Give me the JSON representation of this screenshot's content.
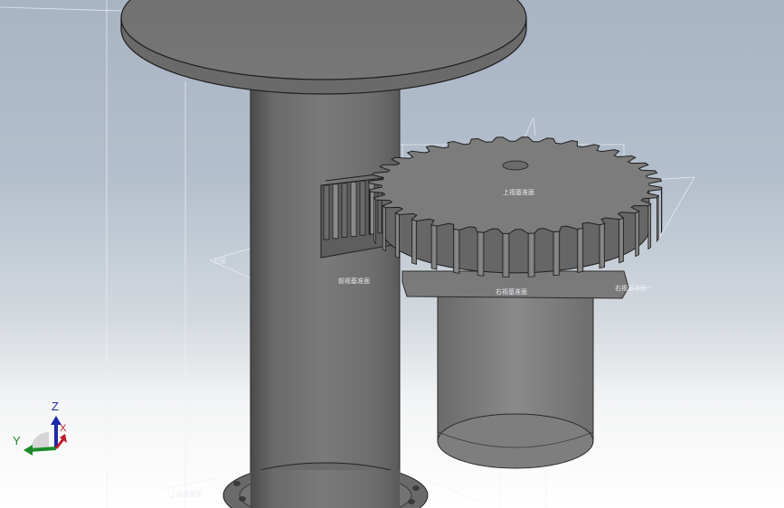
{
  "viewport": {
    "background_top": "#a8b4c4",
    "background_bottom": "#ffffff"
  },
  "model": {
    "body_color": "#707070",
    "edge_color": "#1e1e1e",
    "gear_teeth_count": 36
  },
  "plane_labels": {
    "plane_1": "上视基准面",
    "plane_2": "前视基准面",
    "plane_3": "右视基准面",
    "plane_4": "右视",
    "plane_5": "右视基准面",
    "plane_6": "上视基准面"
  },
  "triad": {
    "z_label": "Z",
    "y_label": "Y",
    "x_label": "X",
    "z_color": "#1c2aa8",
    "y_color": "#1d8a2a",
    "x_color": "#c0182a"
  }
}
